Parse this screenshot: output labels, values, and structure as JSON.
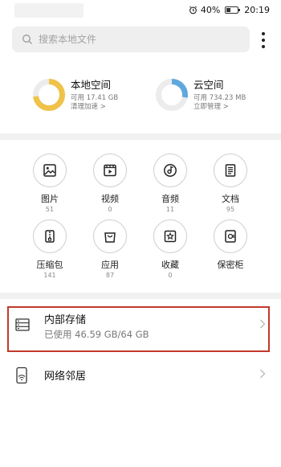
{
  "status_bar": {
    "battery": "40%",
    "time": "20:19",
    "battery_level": 0.4
  },
  "search": {
    "placeholder": "搜索本地文件"
  },
  "storage": {
    "local": {
      "title": "本地空间",
      "available": "可用 17.41 GB",
      "action": "清理加速",
      "used_fraction": 0.73,
      "color": "#f0c24a"
    },
    "cloud": {
      "title": "云空间",
      "available": "可用 734.23 MB",
      "action": "立即管理",
      "used_fraction": 0.28,
      "color": "#5fa8de"
    }
  },
  "categories": [
    {
      "label": "图片",
      "count": "51",
      "icon": "image-icon"
    },
    {
      "label": "视频",
      "count": "0",
      "icon": "video-icon"
    },
    {
      "label": "音频",
      "count": "11",
      "icon": "audio-icon"
    },
    {
      "label": "文档",
      "count": "95",
      "icon": "document-icon"
    },
    {
      "label": "压缩包",
      "count": "141",
      "icon": "archive-icon"
    },
    {
      "label": "应用",
      "count": "87",
      "icon": "app-icon"
    },
    {
      "label": "收藏",
      "count": "0",
      "icon": "favorite-icon"
    },
    {
      "label": "保密柜",
      "count": "",
      "icon": "safe-icon"
    }
  ],
  "list": {
    "internal": {
      "title": "内部存储",
      "sub": "已使用 46.59 GB/64 GB"
    },
    "network": {
      "title": "网络邻居"
    }
  },
  "colors": {
    "highlight": "#c0392b",
    "separator": "#f1f1f1"
  }
}
